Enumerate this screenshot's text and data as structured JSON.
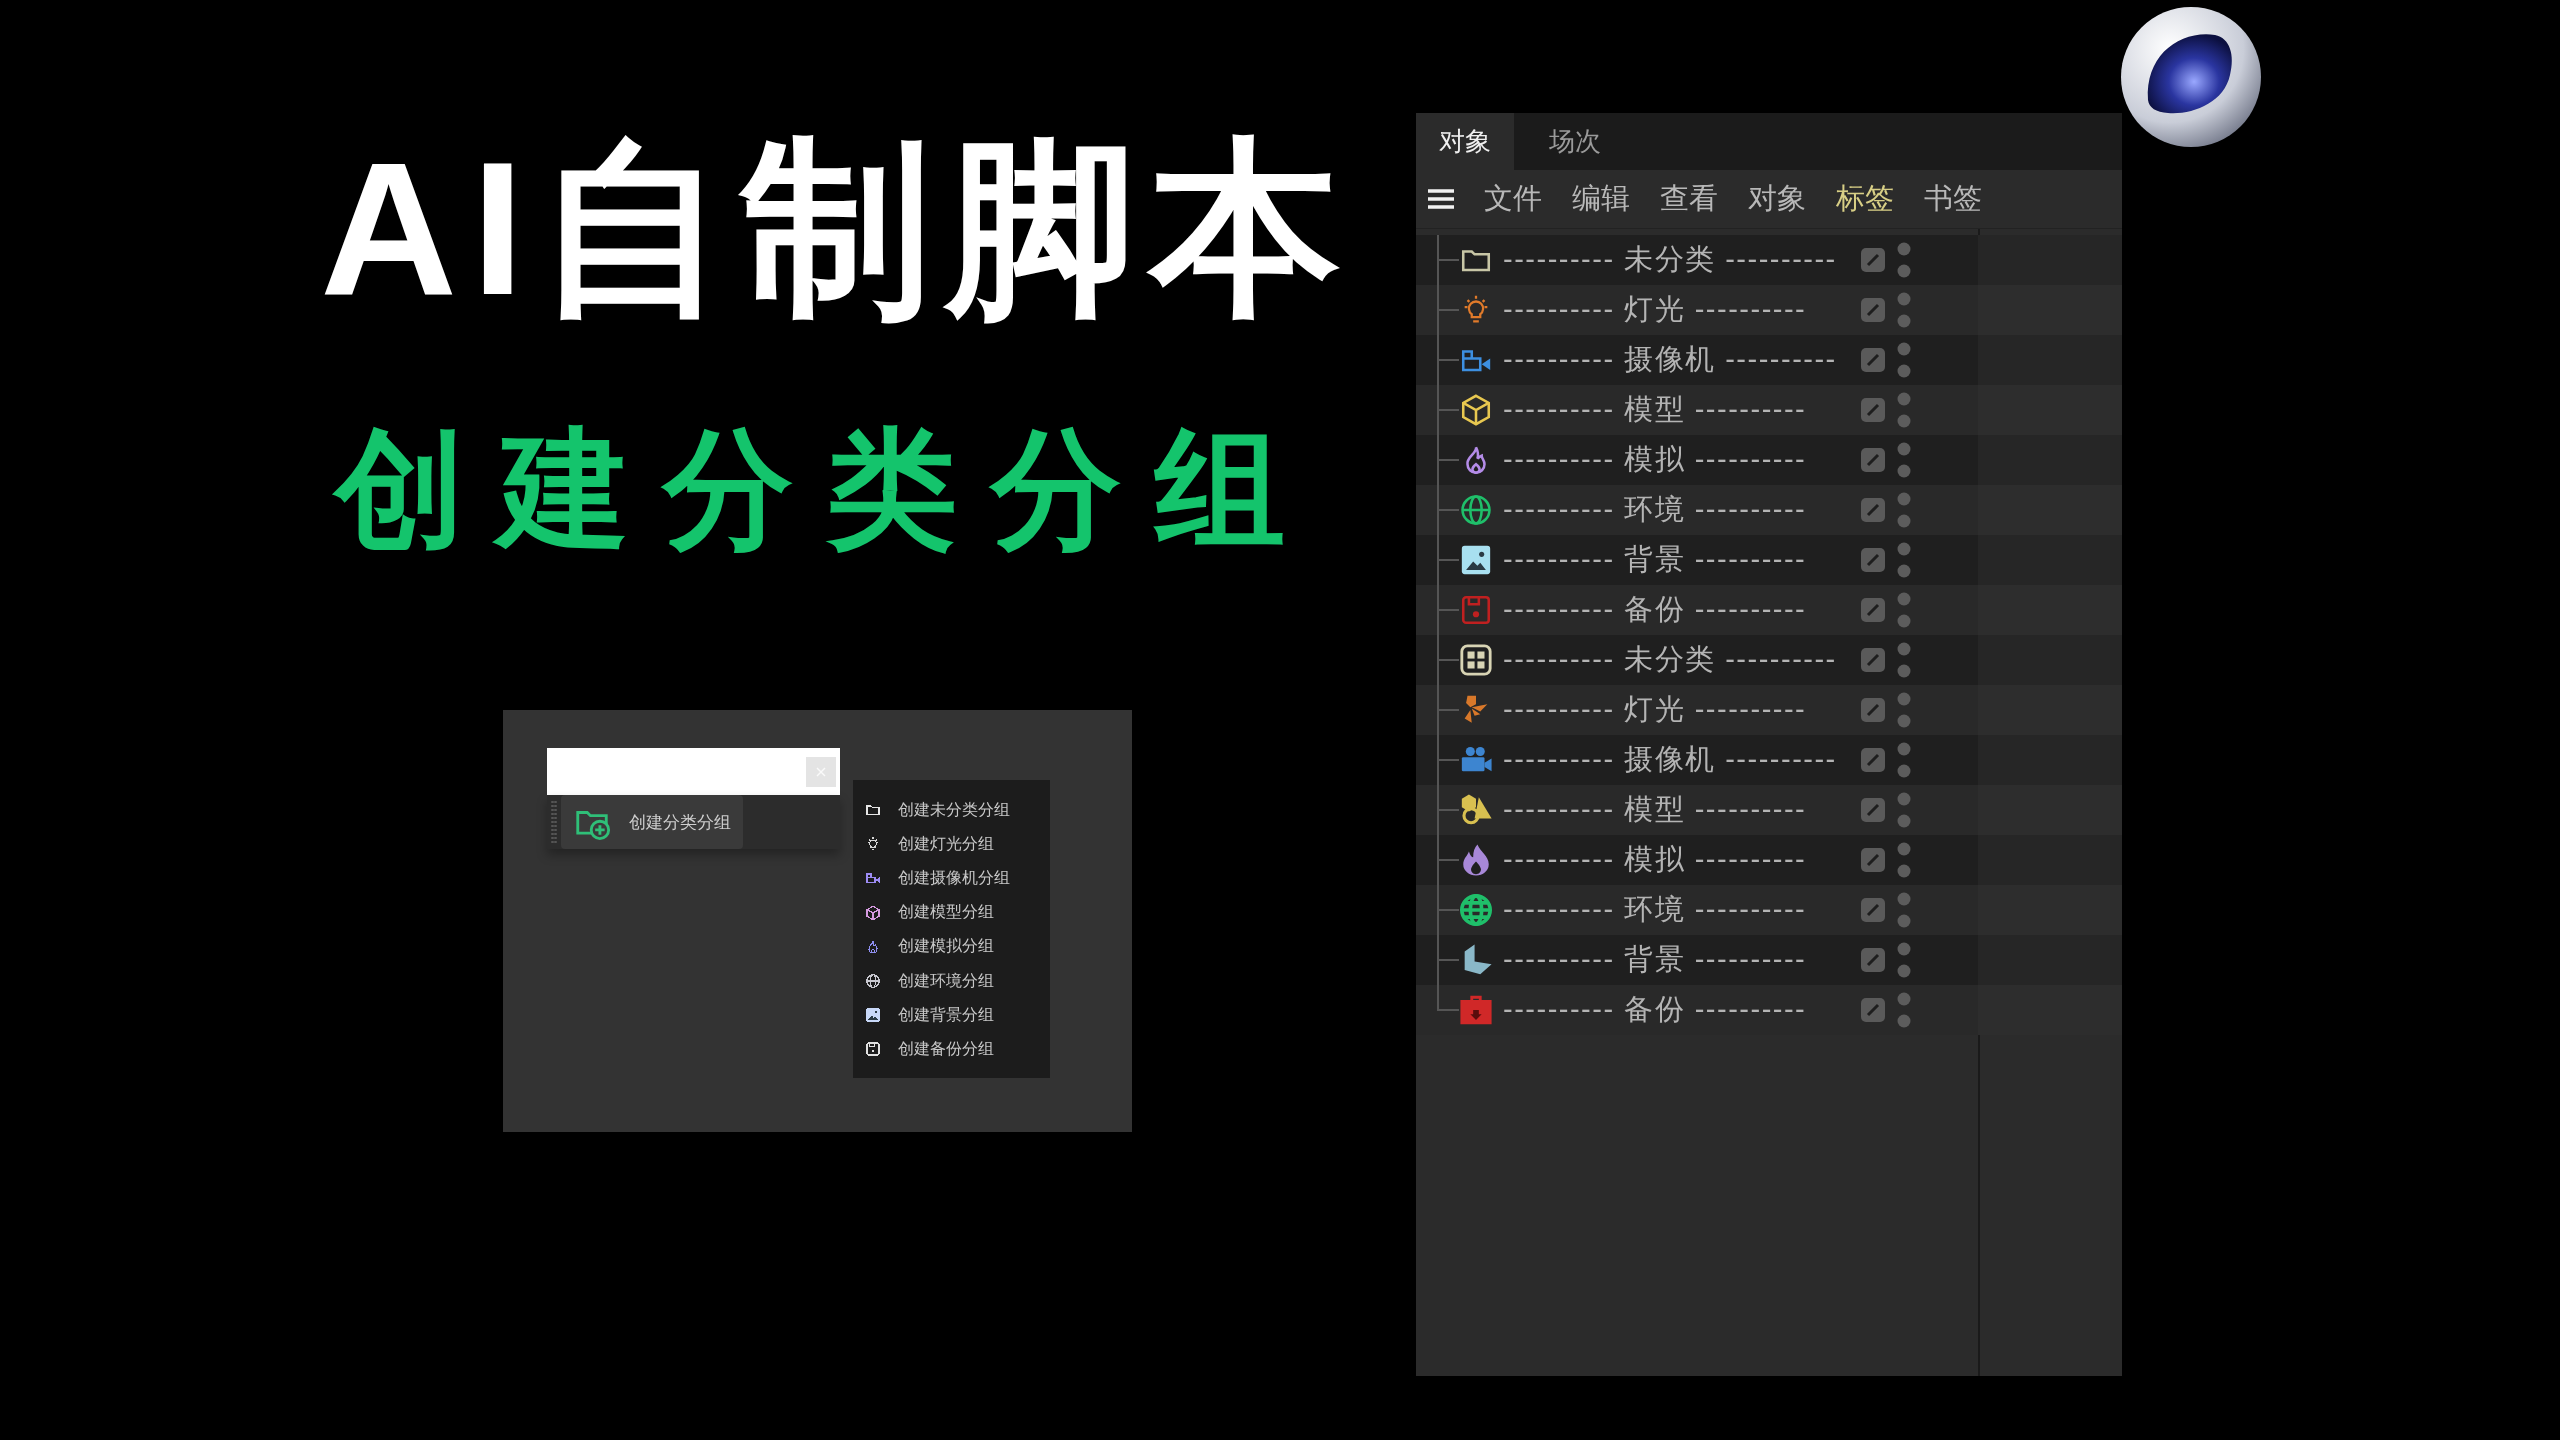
{
  "title": "AI自制脚本",
  "subtitle": "创建分类分组",
  "popup": {
    "button": {
      "label": "创建分类分组"
    },
    "menu": [
      {
        "label": "创建未分类分组",
        "kind": "folder",
        "color": "#e6e6e6"
      },
      {
        "label": "创建灯光分组",
        "kind": "bulb",
        "color": "#d6d6d6"
      },
      {
        "label": "创建摄像机分组",
        "kind": "video",
        "color": "#9d8cf5"
      },
      {
        "label": "创建模型分组",
        "kind": "cube",
        "color": "#d69ae0"
      },
      {
        "label": "创建模拟分组",
        "kind": "flame",
        "color": "#8f8ff0"
      },
      {
        "label": "创建环境分组",
        "kind": "globe",
        "color": "#c8c8d0"
      },
      {
        "label": "创建背景分组",
        "kind": "image",
        "color": "#c8d8f8"
      },
      {
        "label": "创建备份分组",
        "kind": "floppy",
        "color": "#e0e0e0"
      }
    ]
  },
  "object_manager": {
    "tabs": [
      {
        "label": "对象",
        "selected": true
      },
      {
        "label": "场次",
        "selected": false
      }
    ],
    "menu": [
      {
        "label": "文件",
        "highlighted": false
      },
      {
        "label": "编辑",
        "highlighted": false
      },
      {
        "label": "查看",
        "highlighted": false
      },
      {
        "label": "对象",
        "highlighted": false
      },
      {
        "label": "标签",
        "highlighted": true
      },
      {
        "label": "书签",
        "highlighted": false
      }
    ],
    "rows": [
      {
        "label": "---------- 未分类 ----------",
        "kind": "folder",
        "color": "#c8c6a6"
      },
      {
        "label": "---------- 灯光 ----------",
        "kind": "bulb",
        "color": "#e07a2a"
      },
      {
        "label": "---------- 摄像机 ----------",
        "kind": "video",
        "color": "#3d8fe0"
      },
      {
        "label": "---------- 模型 ----------",
        "kind": "cube",
        "color": "#e8c850"
      },
      {
        "label": "---------- 模拟 ----------",
        "kind": "flame",
        "color": "#b48ce8"
      },
      {
        "label": "---------- 环境 ----------",
        "kind": "globe",
        "color": "#1fbf6a"
      },
      {
        "label": "---------- 背景 ----------",
        "kind": "image",
        "color": "#a8e0f0"
      },
      {
        "label": "---------- 备份 ----------",
        "kind": "floppy",
        "color": "#c02020"
      },
      {
        "label": "---------- 未分类 ----------",
        "kind": "grid",
        "color": "#d8d4b4"
      },
      {
        "label": "---------- 灯光 ----------",
        "kind": "spotlight",
        "color": "#d8782a"
      },
      {
        "label": "---------- 摄像机 ----------",
        "kind": "movie",
        "color": "#3d85d0"
      },
      {
        "label": "---------- 模型 ----------",
        "kind": "shapes",
        "color": "#d8c050"
      },
      {
        "label": "---------- 模拟 ----------",
        "kind": "flame-solid",
        "color": "#a888d8"
      },
      {
        "label": "---------- 环境 ----------",
        "kind": "globe-solid",
        "color": "#1fbf6a"
      },
      {
        "label": "---------- 背景 ----------",
        "kind": "floor",
        "color": "#8ab8c8"
      },
      {
        "label": "---------- 备份 ----------",
        "kind": "toolbox",
        "color": "#d02828"
      }
    ]
  }
}
